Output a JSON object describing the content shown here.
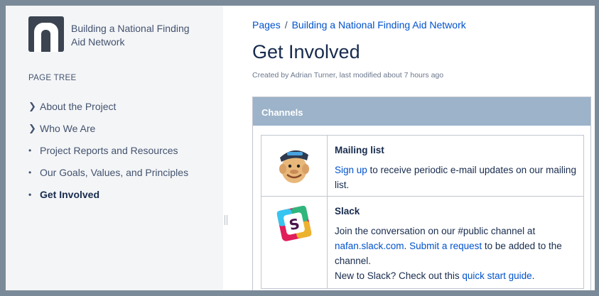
{
  "space": {
    "title": "Building a National Finding Aid Network"
  },
  "sidebar": {
    "page_tree_label": "PAGE TREE",
    "items": [
      {
        "label": "About the Project",
        "marker": "chevron"
      },
      {
        "label": "Who We Are",
        "marker": "chevron"
      },
      {
        "label": "Project Reports and Resources",
        "marker": "bullet"
      },
      {
        "label": "Our Goals, Values, and Principles",
        "marker": "bullet"
      },
      {
        "label": "Get Involved",
        "marker": "bullet",
        "active": true
      }
    ]
  },
  "breadcrumb": {
    "root": "Pages",
    "separator": "/",
    "parent": "Building a National Finding Aid Network"
  },
  "page": {
    "title": "Get Involved",
    "byline": "Created by Adrian Turner, last modified about 7 hours ago"
  },
  "panel": {
    "title": "Channels",
    "rows": [
      {
        "icon": "mailchimp-icon",
        "name": "Mailing list",
        "link1": "Sign up",
        "text1": " to receive periodic e-mail updates on our mailing list."
      },
      {
        "icon": "slack-icon",
        "name": "Slack",
        "text1": "Join the conversation on our #public channel at ",
        "link1": "nafan.slack.com",
        "text2": ". ",
        "link2": "Submit a request",
        "text3": " to be added to the channel.",
        "text4": "New to Slack? Check out this ",
        "link3": "quick start guide",
        "text5": "."
      }
    ]
  },
  "colors": {
    "link": "#0052cc",
    "panel_header": "#9cb3c9",
    "sidebar_bg": "#f4f5f7"
  }
}
